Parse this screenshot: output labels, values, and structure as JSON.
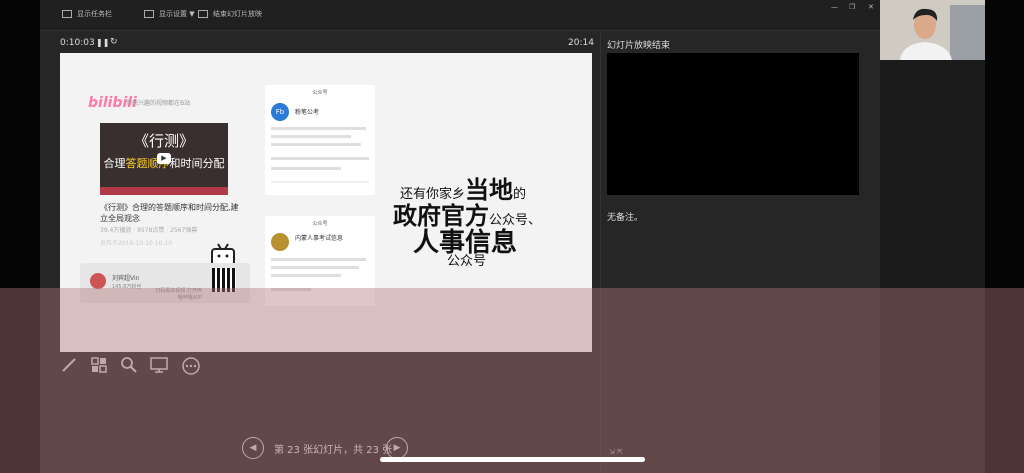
{
  "toolbar": {
    "show_taskbar": "显示任务栏",
    "display_settings": "显示设置 ▼",
    "end_show": "结束幻灯片放映"
  },
  "window_controls": {
    "minimize": "—",
    "restore": "❐",
    "close": "✕"
  },
  "presenter": {
    "elapsed_time": "0:10:03",
    "current_time": "20:14",
    "next_slide_label": "幻灯片放映结束",
    "notes_text": "无备注。",
    "slide_counter": "第 23 张幻灯片，共 23 张"
  },
  "slide": {
    "bili_logo": "bilibili",
    "bili_tagline": "你感兴趣的视频都在B站",
    "video_thumb_title": "《行测》",
    "video_thumb_prefix": "合理",
    "video_thumb_highlight": "答题顺序",
    "video_thumb_suffix": "和时间分配",
    "video_title": "《行测》合理的答题顺序和时间分配,建立全局观念",
    "video_stats": "39.4万播放 · 9578点赞 · 2567弹幕",
    "video_date": "发布于2019-10-10 10:10",
    "uploader_name": "刘宾超Vin",
    "uploader_sub": "145.8万粉丝",
    "open_app": "扫码看本视频 打开哔哩哔哩APP",
    "phone1_header": "公众号",
    "phone1_logo": "Fb",
    "phone1_name": "粉笔公考",
    "phone2_header": "公众号",
    "phone2_name": "内蒙人事考试信息",
    "callout_line1_a": "还有你家乡",
    "callout_line1_b": "当地",
    "callout_line1_c": "的",
    "callout_line2_a": "政府官方",
    "callout_line2_b": "公众号、",
    "callout_line3": "人事信息",
    "callout_line4": "公众号"
  },
  "tools": {
    "pen": "pen-icon",
    "grid": "slides-grid-icon",
    "zoom": "magnifier-icon",
    "screen": "screen-icon",
    "more": "more-icon"
  },
  "nav": {
    "prev": "◀",
    "next": "▶"
  },
  "colors": {
    "overlay": "#b47878",
    "bili_pink": "#ff7aa8",
    "thumb_highlight": "#ffd21e",
    "window_bg": "#262626"
  }
}
